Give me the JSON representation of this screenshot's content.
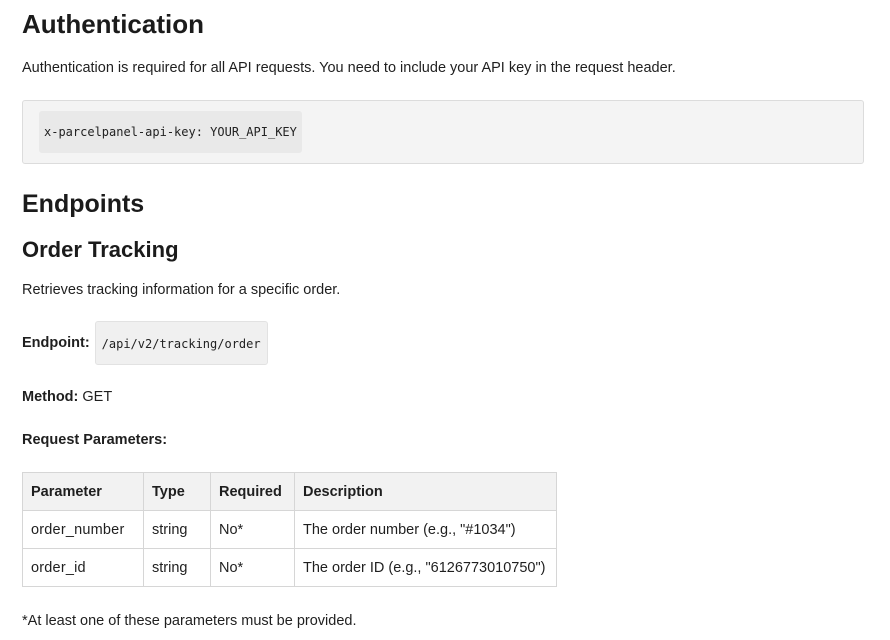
{
  "auth": {
    "heading": "Authentication",
    "description": "Authentication is required for all API requests. You need to include your API key in the request header.",
    "header_code": "x-parcelpanel-api-key: YOUR_API_KEY"
  },
  "endpoints": {
    "heading": "Endpoints",
    "order_tracking": {
      "heading": "Order Tracking",
      "description": "Retrieves tracking information for a specific order.",
      "endpoint_label": "Endpoint:",
      "endpoint_path": "/api/v2/tracking/order",
      "method_label": "Method:",
      "method_value": "GET",
      "params_heading": "Request Parameters:",
      "table": {
        "headers": [
          "Parameter",
          "Type",
          "Required",
          "Description"
        ],
        "rows": [
          [
            "order_number",
            "string",
            "No*",
            "The order number (e.g., \"#1034\")"
          ],
          [
            "order_id",
            "string",
            "No*",
            "The order ID (e.g., \"6126773010750\")"
          ]
        ]
      },
      "footnote": "*At least one of these parameters must be provided."
    }
  }
}
